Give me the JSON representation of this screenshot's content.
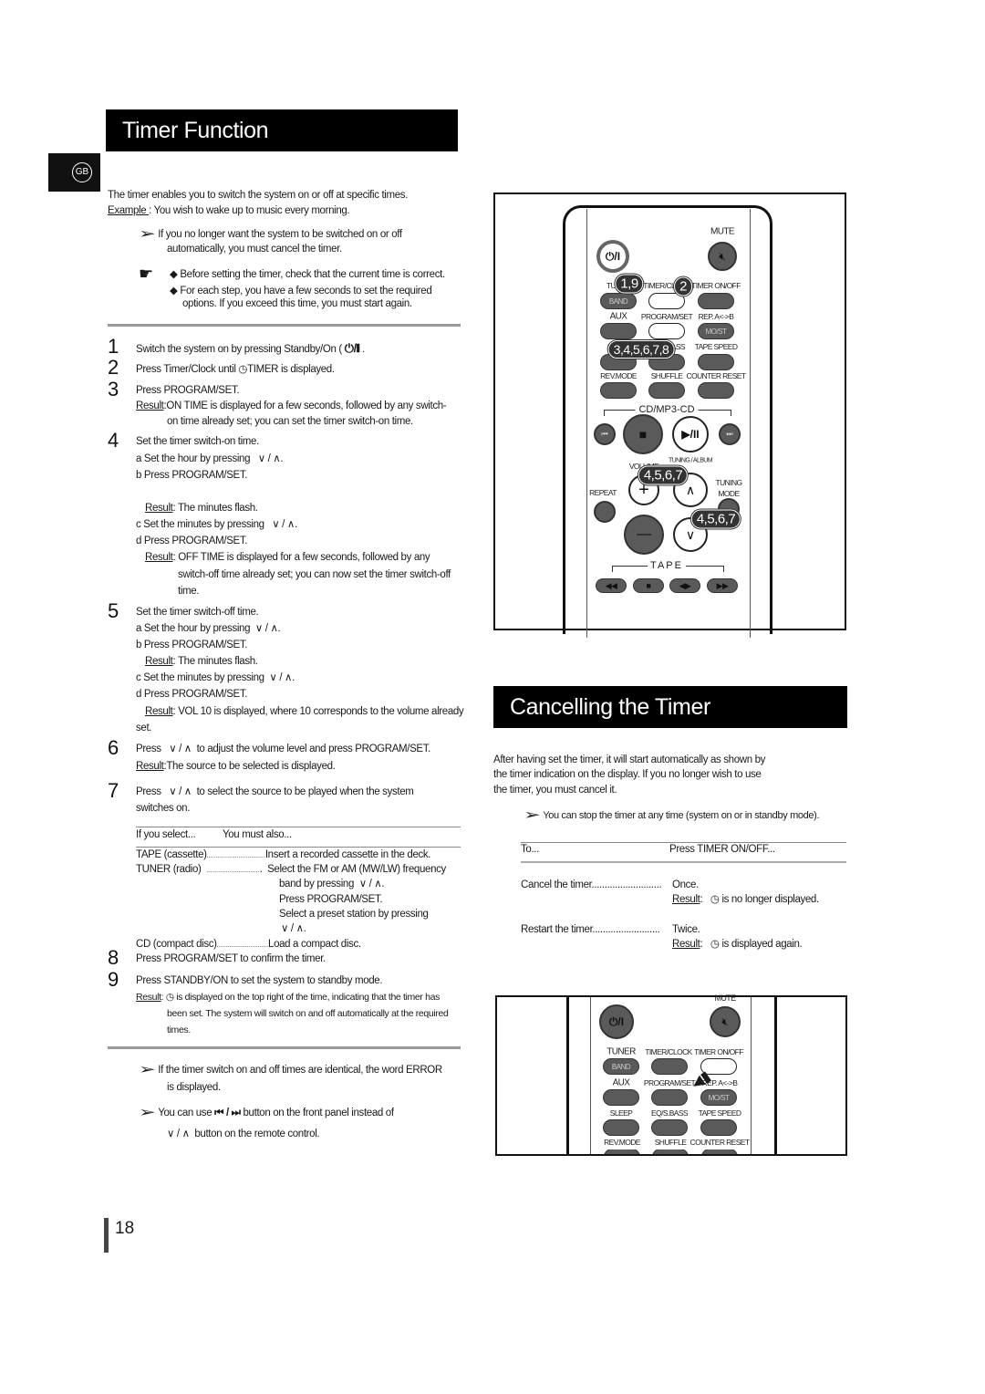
{
  "header": {
    "title": "Timer Function",
    "lang_badge": "GB"
  },
  "intro": {
    "text": "The timer enables you to switch the system on or off at specific times.",
    "example_label": "Example ",
    "example_text": ": You wish to wake up to music every morning.",
    "note1_line1": "If you no longer want the system to be switched on or off",
    "note1_line2": "automatically, you must cancel the timer.",
    "tip1": "Before setting the timer, check that the current time is correct.",
    "tip2_line1": "For each step, you have a few seconds to set the required",
    "tip2_line2": "options. If you exceed this time, you must start again."
  },
  "steps": {
    "s1": {
      "num": "1",
      "text": "Switch the system on by pressing Standby/On (",
      "icon": "⏻/❙",
      "end": "."
    },
    "s2": {
      "num": "2",
      "pre": "Press Timer/Clock until",
      "post": "TIMER is displayed."
    },
    "s3": {
      "num": "3",
      "text": "Press PROGRAM/SET.",
      "result_label": "Result",
      "result_line1": ":ON TIME is displayed  for a few seconds, followed by any switch-",
      "result_line2": "on time already set; you can set the timer switch-on time."
    },
    "s4": {
      "num": "4",
      "text": "Set the timer switch-on time.",
      "a": "a Set the hour by pressing",
      "b": "b Press  PROGRAM/SET.",
      "result_b": ": The minutes flash.",
      "c": "c Set the minutes by pressing",
      "d": "d Press  PROGRAM/SET.",
      "result_d1": ": OFF TIME is displayed  for a few seconds, followed by any",
      "result_d2": "switch-off time already set; you can now set the timer switch-off",
      "result_d3": "time."
    },
    "s5": {
      "num": "5",
      "text": "Set the timer switch-off time.",
      "a": "a Set the hour by pressing",
      "b": "b Press  PROGRAM/SET.",
      "result_b": ": The minutes flash.",
      "c": "c Set the minutes by pressing",
      "d": "d Press  PROGRAM/SET.",
      "result_d1": ": VOL 10 is displayed, where 10 corresponds to the volume already",
      "result_d2": "set."
    },
    "s6": {
      "num": "6",
      "pre": "Press",
      "post": "to adjust the volume level and press PROGRAM/SET.",
      "result": ":The source to be selected is displayed."
    },
    "s7": {
      "num": "7",
      "pre": "Press",
      "post": "to select the source to be played when the system",
      "line2": "switches on."
    },
    "s8": {
      "num": "8",
      "text": "Press  PROGRAM/SET to confirm the timer."
    },
    "s9": {
      "num": "9",
      "text": "Press STANDBY/ON  to set the system to standby mode.",
      "result1": "is displayed on the top right of the time, indicating that the timer has",
      "result2": "been set. The system will switch on and off automatically at the required",
      "result3": "times."
    }
  },
  "arrows": {
    "down_up": "∨ / ∧",
    "result_label": "Result"
  },
  "source_table": {
    "header_col1": "If you select...",
    "header_col2": "You must also...",
    "tape": "TAPE (cassette)",
    "tape_action": "Insert a recorded cassette in the deck.",
    "tuner": "TUNER (radio)",
    "tuner_action1": "Select the FM or AM (MW/LW) frequency",
    "tuner_action2": "band by pressing",
    "tuner_action3": "Press PROGRAM/SET.",
    "tuner_action4": "Select a preset station by pressing",
    "cd": "CD (compact disc)",
    "cd_action": "Load a compact disc."
  },
  "footer_notes": {
    "note1_line1": "If the timer switch on and off times are identical, the word ERROR",
    "note1_line2": "is displayed.",
    "note2_pre": "You can use",
    "note2_icons": "⏮ / ⏭",
    "note2_post": "button on the front panel instead of",
    "note2_line2": "button on the remote control."
  },
  "page_number": "18",
  "cancel": {
    "title": "Cancelling the Timer",
    "para1": "After having set the timer, it will start automatically as shown by",
    "para2": "the timer indication on the display. If you no longer wish to use",
    "para3": "the timer, you must cancel it.",
    "note": "You can stop the timer at any time (system on or in standby mode).",
    "col1": "To...",
    "col2": "Press TIMER ON/OFF...",
    "row1_action": "Cancel the timer",
    "row1_press": "Once.",
    "row1_result": "is no longer displayed.",
    "row2_action": "Restart the timer",
    "row2_press": "Twice.",
    "row2_result": "is displayed again."
  },
  "remote": {
    "mute": "MUTE",
    "tuner": "TUNER",
    "band": "BAND",
    "timer_clock": "TIMER/CLOCK",
    "timer_onoff": "TIMER ON/OFF",
    "aux": "AUX",
    "program_set": "PROGRAM/SET",
    "rep_ab": "REP. A<->B",
    "most": "MO/ST",
    "sleep": "SLEEP",
    "eq_sbass": "EQ/S.BASS",
    "tape_speed": "TAPE SPEED",
    "rev_mode": "REV.MODE",
    "shuffle": "SHUFFLE",
    "counter_reset": "COUNTER RESET",
    "cd_mp3_cd": "CD/MP3-CD",
    "tuning_album": "TUNING / ALBUM",
    "volume": "VOLUME",
    "repeat": "REPEAT",
    "tuning_mode_1": "TUNING",
    "tuning_mode_2": "MODE",
    "tape": "TAPE",
    "callouts": [
      "1,9",
      "2",
      "3,4,5,6,7,8",
      "4,5,6,7",
      "4,5,6,7"
    ]
  }
}
